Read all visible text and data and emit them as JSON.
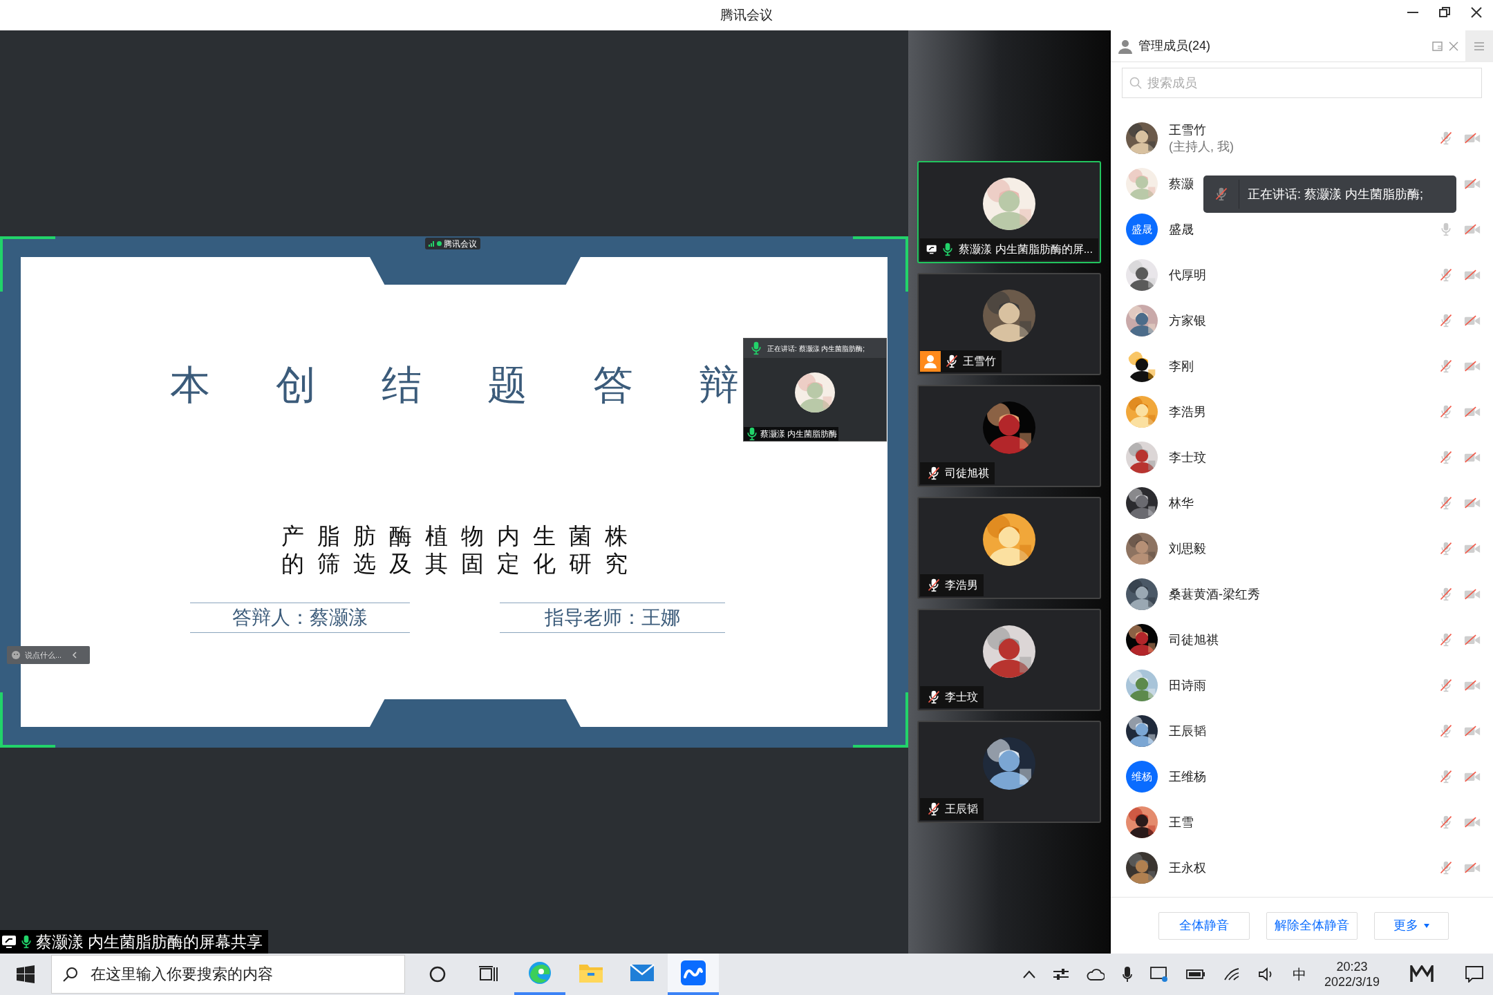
{
  "window": {
    "title": "腾讯会议"
  },
  "stage": {
    "slide": {
      "title": "本创结题答辩",
      "subtitle_lines": [
        "产脂肪酶植物内生菌株",
        "的筛选及其固定化研究"
      ],
      "presenter": "答辩人：蔡灏漾",
      "advisor": "指导老师：王娜"
    },
    "app_tag": "腾讯会议",
    "speaker_window": {
      "header": "正在讲话: 蔡灏漾 内生菌脂肪酶;",
      "name": "蔡灏漾 内生菌脂肪酶"
    },
    "chat_input": {
      "placeholder": "说点什么..."
    },
    "share_label": "蔡灏漾 内生菌脂肪酶的屏幕共享"
  },
  "tiles": [
    {
      "name": "蔡灏漾 内生菌脂肪酶的屏...",
      "speaking": true,
      "sharing": true,
      "host": false,
      "muted": false
    },
    {
      "name": "王雪竹",
      "speaking": false,
      "sharing": false,
      "host": true,
      "muted": true
    },
    {
      "name": "司徒旭祺",
      "speaking": false,
      "sharing": false,
      "host": false,
      "muted": true
    },
    {
      "name": "李浩男",
      "speaking": false,
      "sharing": false,
      "host": false,
      "muted": true
    },
    {
      "name": "李士玟",
      "speaking": false,
      "sharing": false,
      "host": false,
      "muted": true
    },
    {
      "name": "王辰韬",
      "speaking": false,
      "sharing": false,
      "host": false,
      "muted": true
    }
  ],
  "members_panel": {
    "title": "管理成员(24)",
    "search": {
      "placeholder": "搜索成员"
    },
    "tooltip": "正在讲话: 蔡灏漾 内生菌脂肪酶;",
    "members": [
      {
        "name": "王雪竹",
        "note": "(主持人, 我)",
        "muted": true
      },
      {
        "name": "蔡灏"
      },
      {
        "name": "盛晟",
        "avatar": {
          "kind": "initials",
          "text": "盛晟"
        },
        "muted": false
      },
      {
        "name": "代厚明",
        "muted": true
      },
      {
        "name": "方家银",
        "muted": true
      },
      {
        "name": "李刚",
        "muted": true
      },
      {
        "name": "李浩男",
        "muted": true
      },
      {
        "name": "李士玟",
        "muted": true
      },
      {
        "name": "林华",
        "muted": true
      },
      {
        "name": "刘思毅",
        "muted": true
      },
      {
        "name": "桑葚黄酒-梁红秀",
        "muted": true
      },
      {
        "name": "司徒旭祺",
        "muted": true
      },
      {
        "name": "田诗雨",
        "muted": true
      },
      {
        "name": "王辰韬",
        "muted": true
      },
      {
        "name": "王维杨",
        "avatar": {
          "kind": "initials",
          "text": "维杨"
        },
        "muted": true
      },
      {
        "name": "王雪",
        "muted": true
      },
      {
        "name": "王永权",
        "muted": true
      }
    ],
    "buttons": [
      {
        "label": "全体静音",
        "dropdown": false
      },
      {
        "label": "解除全体静音",
        "dropdown": false
      },
      {
        "label": "更多",
        "dropdown": true
      }
    ]
  },
  "taskbar": {
    "search": {
      "placeholder": "在这里输入你要搜索的内容"
    },
    "apps": [
      {
        "kind": "edge",
        "running": true,
        "active": false
      },
      {
        "kind": "folder",
        "running": false,
        "active": false
      },
      {
        "kind": "mail",
        "running": false,
        "active": false
      },
      {
        "kind": "meeting",
        "running": true,
        "active": true
      }
    ],
    "ime": "中",
    "time": "20:23",
    "date": "2022/3/19"
  }
}
